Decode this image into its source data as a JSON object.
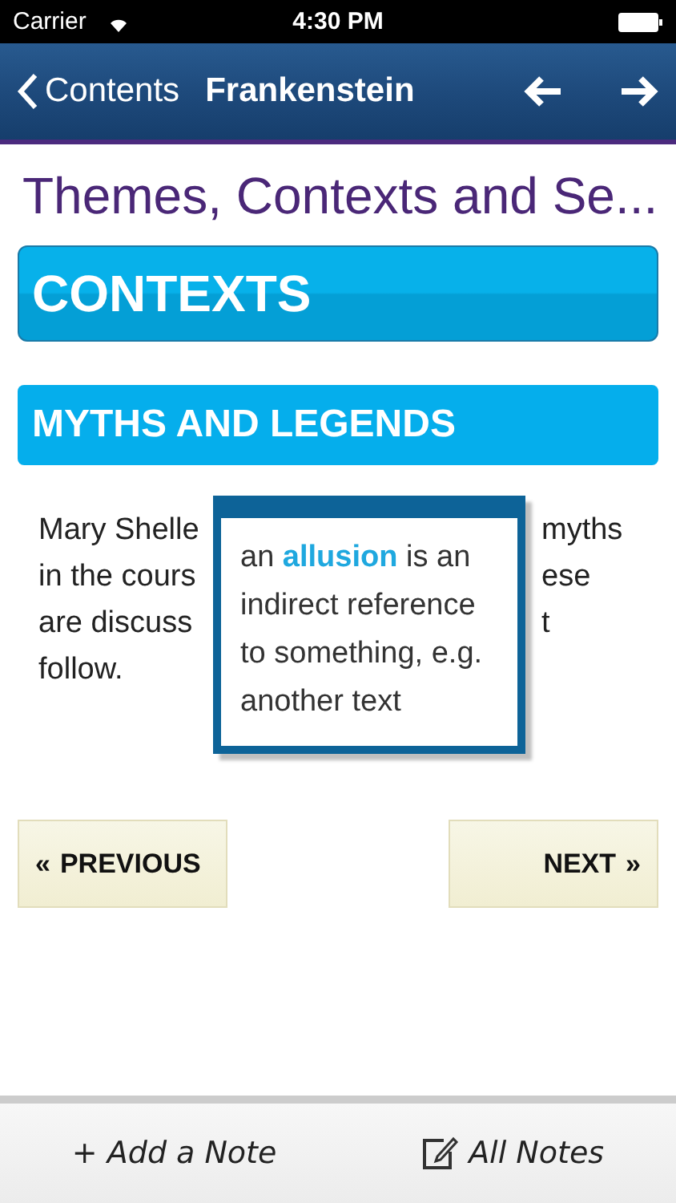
{
  "status_bar": {
    "carrier": "Carrier",
    "time": "4:30 PM"
  },
  "nav_bar": {
    "back": "Contents",
    "title": "Frankenstein"
  },
  "page_title": "Themes, Contexts and Se...",
  "section_heading": "CONTEXTS",
  "subheading": "MYTHS AND LEGENDS",
  "paragraph_lines": [
    {
      "left": "Mary Shelle",
      "right": "myths"
    },
    {
      "left": "in the cours",
      "right": "ese"
    },
    {
      "left": "are discuss",
      "right": "t"
    },
    {
      "left": "follow."
    }
  ],
  "popup": {
    "text": "an **allusion** is an indirect reference to something, e.g. another text"
  },
  "pager": {
    "previous": "PREVIOUS",
    "previous_glyph": "«",
    "next": "NEXT",
    "next_glyph": "»"
  },
  "toolbar": {
    "add_note": "+ Add a Note",
    "all_notes": "All Notes"
  }
}
